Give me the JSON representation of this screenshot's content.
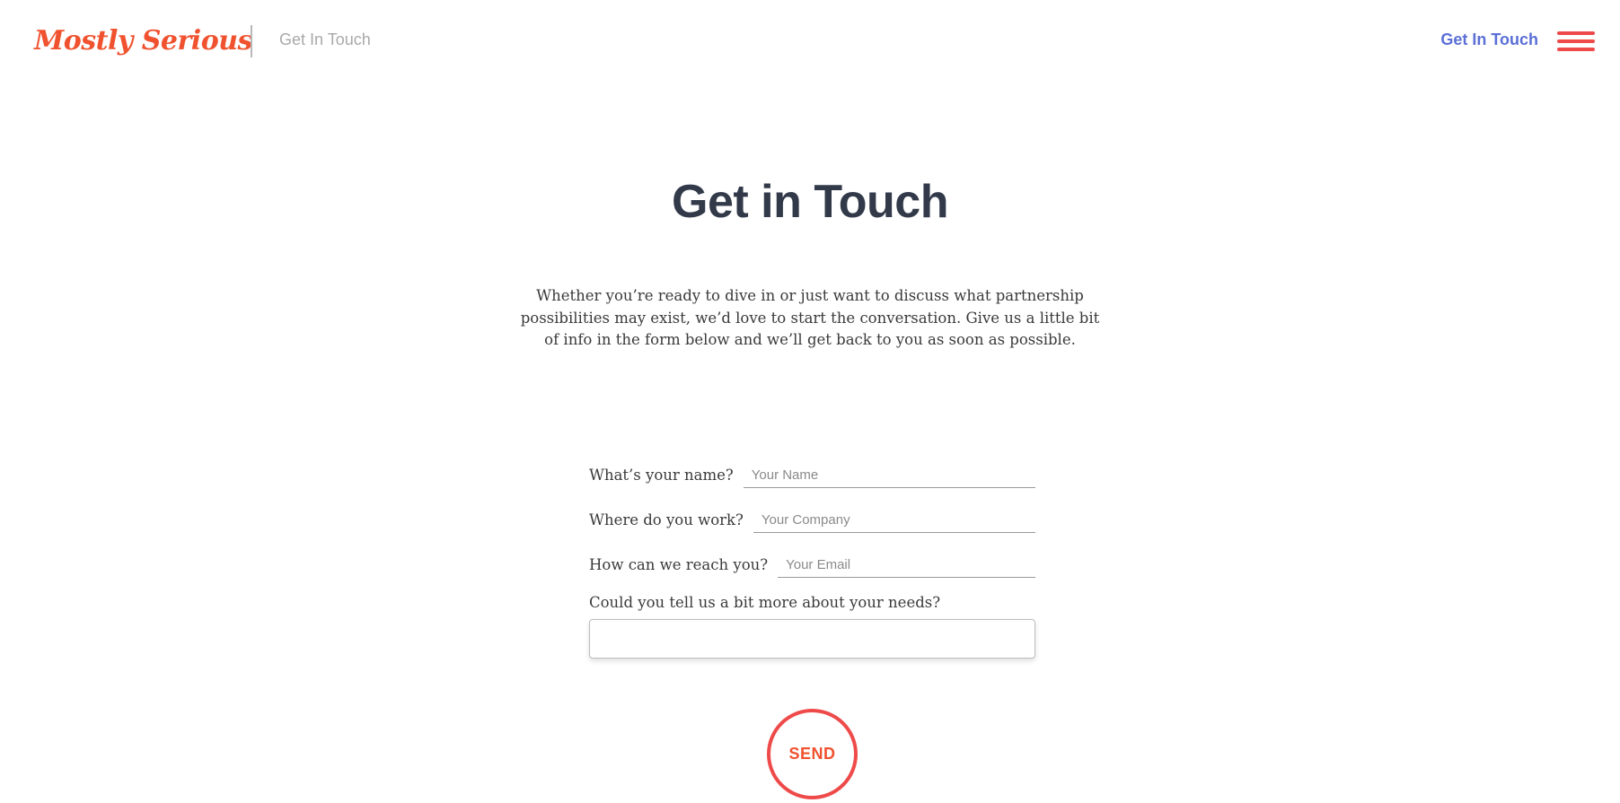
{
  "header": {
    "logo_text": "Mostly Serious",
    "breadcrumb": "Get In Touch",
    "nav_link": "Get In Touch",
    "menu_icon": "hamburger-menu-icon"
  },
  "main": {
    "title": "Get in Touch",
    "intro": "Whether you’re ready to dive in or just want to discuss what partnership possibilities may exist, we’d love to start the conversation. Give us a little bit of info in the form below and we’ll get back to you as soon as possible."
  },
  "form": {
    "name": {
      "label": "What’s your name?",
      "placeholder": "Your Name"
    },
    "company": {
      "label": "Where do you work?",
      "placeholder": "Your Company"
    },
    "email": {
      "label": "How can we reach you?",
      "placeholder": "Your Email"
    },
    "needs": {
      "label": "Could you tell us a bit more about your needs?"
    },
    "send_label": "SEND"
  },
  "colors": {
    "brand": "#f0522f",
    "accent_red": "#ef4a4a",
    "nav_blue": "#5b6fd6",
    "title": "#323a4a"
  }
}
